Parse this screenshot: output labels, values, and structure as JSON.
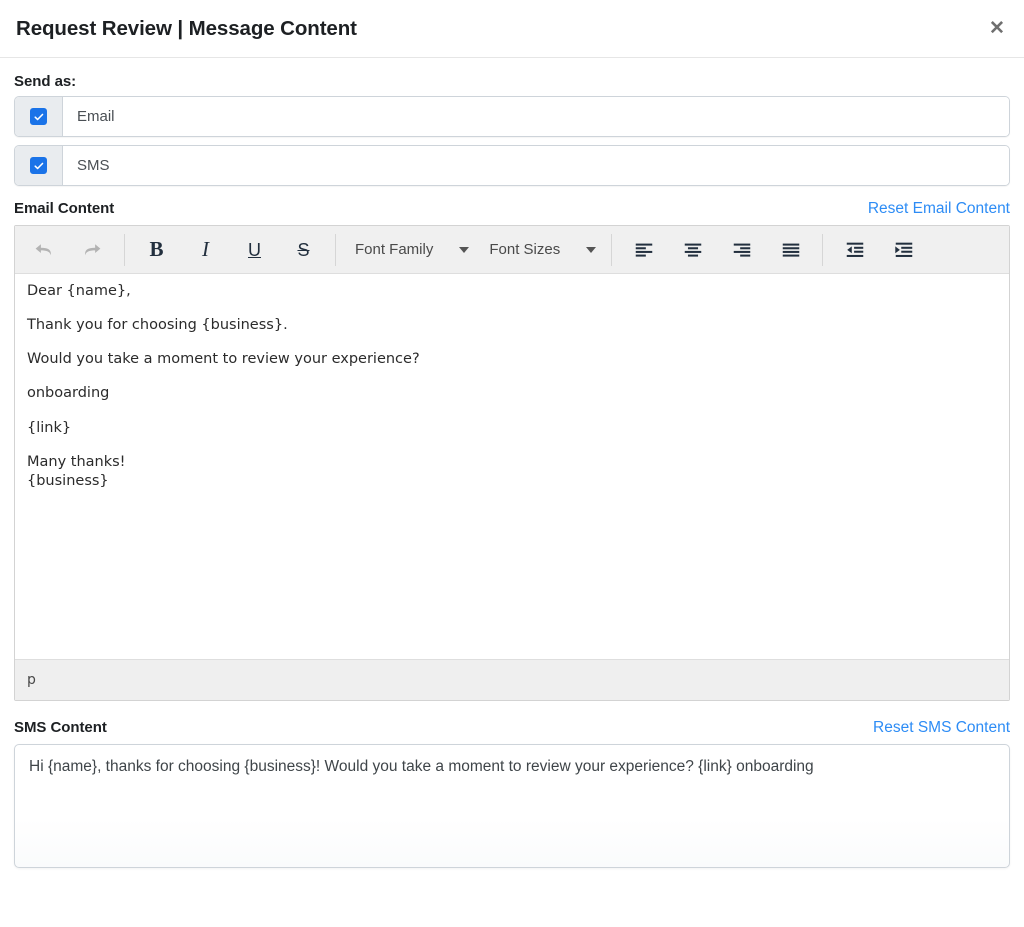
{
  "header": {
    "title": "Request Review | Message Content",
    "close_label": "✕"
  },
  "send_as": {
    "label": "Send as:",
    "options": [
      {
        "label": "Email",
        "checked": true
      },
      {
        "label": "SMS",
        "checked": true
      }
    ]
  },
  "email_section": {
    "title": "Email Content",
    "reset_label": "Reset Email Content"
  },
  "toolbar": {
    "undo_label": "↩",
    "redo_label": "↪",
    "bold_label": "B",
    "italic_label": "I",
    "underline_label": "U",
    "strikethrough_label": "S",
    "font_family_label": "Font Family",
    "font_sizes_label": "Font Sizes",
    "align_left_label": "align-left",
    "align_center_label": "align-center",
    "align_right_label": "align-right",
    "align_justify_label": "align-justify",
    "outdent_label": "outdent",
    "indent_label": "indent"
  },
  "email_body": {
    "paragraphs": [
      "Dear {name},",
      "Thank you for choosing {business}.",
      "Would you take a moment to review your experience?",
      "onboarding",
      "{link}"
    ],
    "closing_line_1": "Many thanks!",
    "closing_line_2": "{business}"
  },
  "editor_status": {
    "element_path": "p"
  },
  "sms_section": {
    "title": "SMS Content",
    "reset_label": "Reset SMS Content",
    "value": "Hi {name}, thanks for choosing {business}! Would you take a moment to review your experience? {link} onboarding",
    "placeholder": ""
  },
  "colors": {
    "link": "#2d8cf5",
    "checkbox": "#1a73e8",
    "toolbar_bg": "#f0f0f0",
    "addon_bg": "#e9ecef"
  }
}
